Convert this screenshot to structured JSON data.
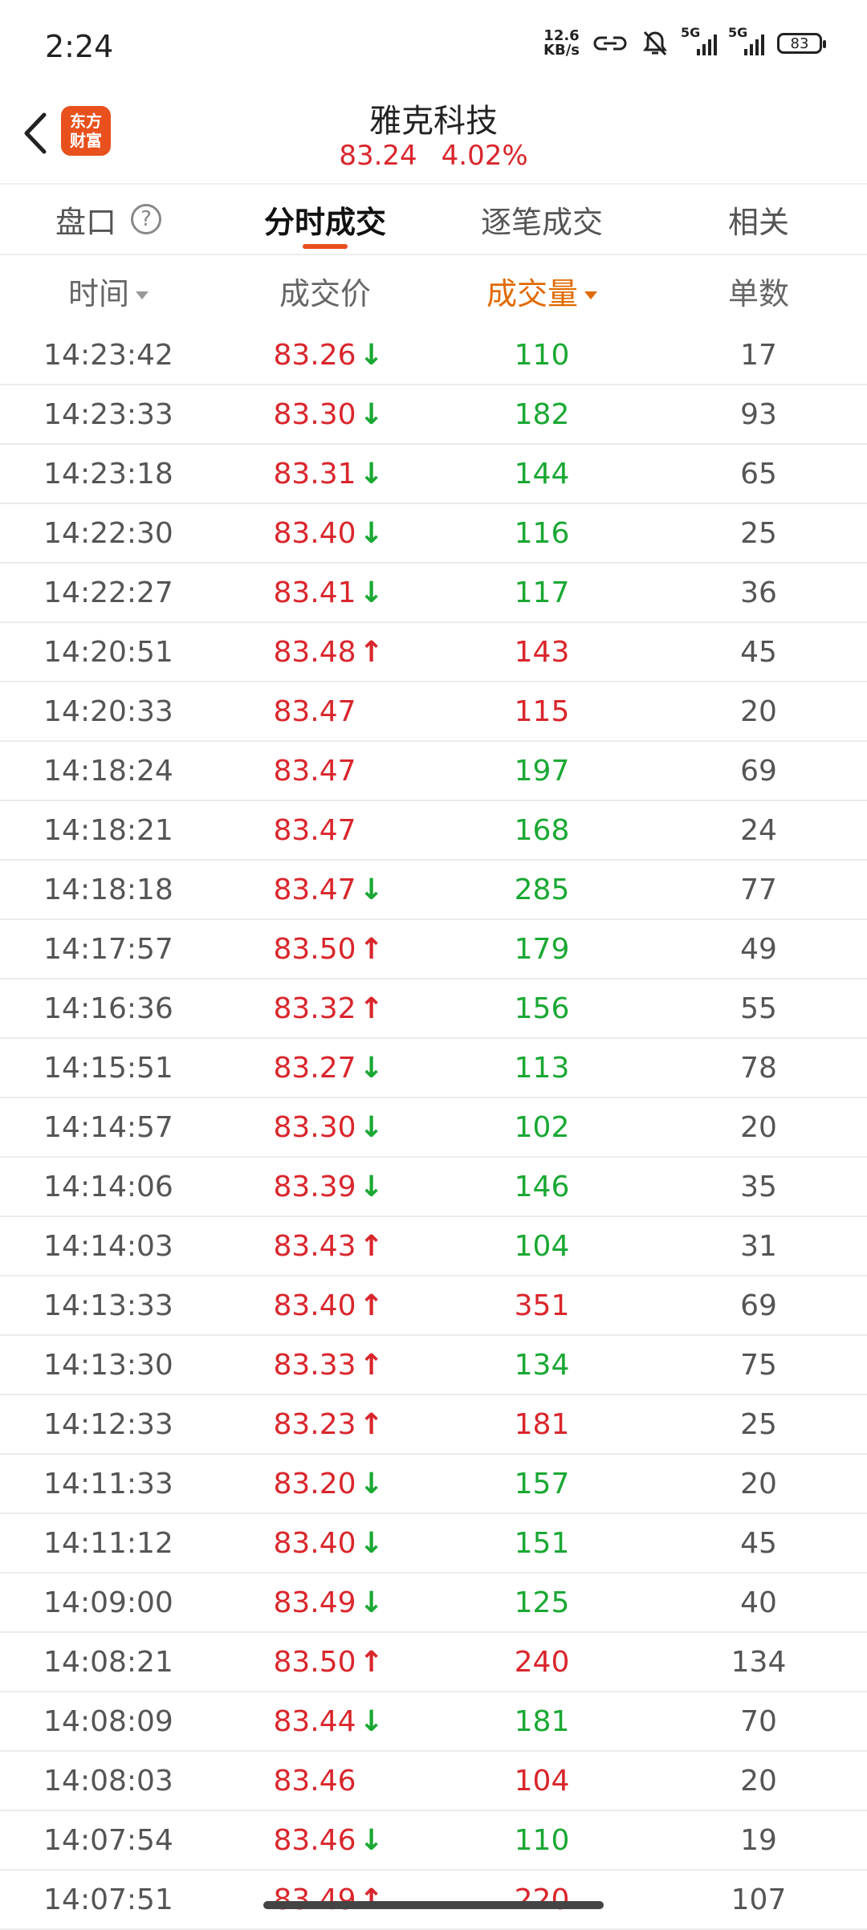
{
  "status": {
    "time": "2:24",
    "net_speed_value": "12.6",
    "net_speed_unit": "KB/s",
    "sig1": "5G",
    "sig2": "5G",
    "battery": "83"
  },
  "header": {
    "title": "雅克科技",
    "price": "83.24",
    "change": "4.02%",
    "logo_line1": "东方",
    "logo_line2": "财富"
  },
  "tabs": [
    "盘口",
    "分时成交",
    "逐笔成交",
    "相关"
  ],
  "columns": {
    "time": "时间",
    "price": "成交价",
    "volume": "成交量",
    "count": "单数"
  },
  "rows": [
    {
      "time": "14:23:42",
      "price": "83.26",
      "dir": "down",
      "volume": "110",
      "vol_color": "green",
      "count": "17"
    },
    {
      "time": "14:23:33",
      "price": "83.30",
      "dir": "down",
      "volume": "182",
      "vol_color": "green",
      "count": "93"
    },
    {
      "time": "14:23:18",
      "price": "83.31",
      "dir": "down",
      "volume": "144",
      "vol_color": "green",
      "count": "65"
    },
    {
      "time": "14:22:30",
      "price": "83.40",
      "dir": "down",
      "volume": "116",
      "vol_color": "green",
      "count": "25"
    },
    {
      "time": "14:22:27",
      "price": "83.41",
      "dir": "down",
      "volume": "117",
      "vol_color": "green",
      "count": "36"
    },
    {
      "time": "14:20:51",
      "price": "83.48",
      "dir": "up",
      "volume": "143",
      "vol_color": "red",
      "count": "45"
    },
    {
      "time": "14:20:33",
      "price": "83.47",
      "dir": "none",
      "volume": "115",
      "vol_color": "red",
      "count": "20"
    },
    {
      "time": "14:18:24",
      "price": "83.47",
      "dir": "none",
      "volume": "197",
      "vol_color": "green",
      "count": "69"
    },
    {
      "time": "14:18:21",
      "price": "83.47",
      "dir": "none",
      "volume": "168",
      "vol_color": "green",
      "count": "24"
    },
    {
      "time": "14:18:18",
      "price": "83.47",
      "dir": "down",
      "volume": "285",
      "vol_color": "green",
      "count": "77"
    },
    {
      "time": "14:17:57",
      "price": "83.50",
      "dir": "up",
      "volume": "179",
      "vol_color": "green",
      "count": "49"
    },
    {
      "time": "14:16:36",
      "price": "83.32",
      "dir": "up",
      "volume": "156",
      "vol_color": "green",
      "count": "55"
    },
    {
      "time": "14:15:51",
      "price": "83.27",
      "dir": "down",
      "volume": "113",
      "vol_color": "green",
      "count": "78"
    },
    {
      "time": "14:14:57",
      "price": "83.30",
      "dir": "down",
      "volume": "102",
      "vol_color": "green",
      "count": "20"
    },
    {
      "time": "14:14:06",
      "price": "83.39",
      "dir": "down",
      "volume": "146",
      "vol_color": "green",
      "count": "35"
    },
    {
      "time": "14:14:03",
      "price": "83.43",
      "dir": "up",
      "volume": "104",
      "vol_color": "green",
      "count": "31"
    },
    {
      "time": "14:13:33",
      "price": "83.40",
      "dir": "up",
      "volume": "351",
      "vol_color": "red",
      "count": "69"
    },
    {
      "time": "14:13:30",
      "price": "83.33",
      "dir": "up",
      "volume": "134",
      "vol_color": "green",
      "count": "75"
    },
    {
      "time": "14:12:33",
      "price": "83.23",
      "dir": "up",
      "volume": "181",
      "vol_color": "red",
      "count": "25"
    },
    {
      "time": "14:11:33",
      "price": "83.20",
      "dir": "down",
      "volume": "157",
      "vol_color": "green",
      "count": "20"
    },
    {
      "time": "14:11:12",
      "price": "83.40",
      "dir": "down",
      "volume": "151",
      "vol_color": "green",
      "count": "45"
    },
    {
      "time": "14:09:00",
      "price": "83.49",
      "dir": "down",
      "volume": "125",
      "vol_color": "green",
      "count": "40"
    },
    {
      "time": "14:08:21",
      "price": "83.50",
      "dir": "up",
      "volume": "240",
      "vol_color": "red",
      "count": "134"
    },
    {
      "time": "14:08:09",
      "price": "83.44",
      "dir": "down",
      "volume": "181",
      "vol_color": "green",
      "count": "70"
    },
    {
      "time": "14:08:03",
      "price": "83.46",
      "dir": "none",
      "volume": "104",
      "vol_color": "red",
      "count": "20"
    },
    {
      "time": "14:07:54",
      "price": "83.46",
      "dir": "down",
      "volume": "110",
      "vol_color": "green",
      "count": "19"
    },
    {
      "time": "14:07:51",
      "price": "83.49",
      "dir": "up",
      "volume": "220",
      "vol_color": "red",
      "count": "107"
    }
  ]
}
